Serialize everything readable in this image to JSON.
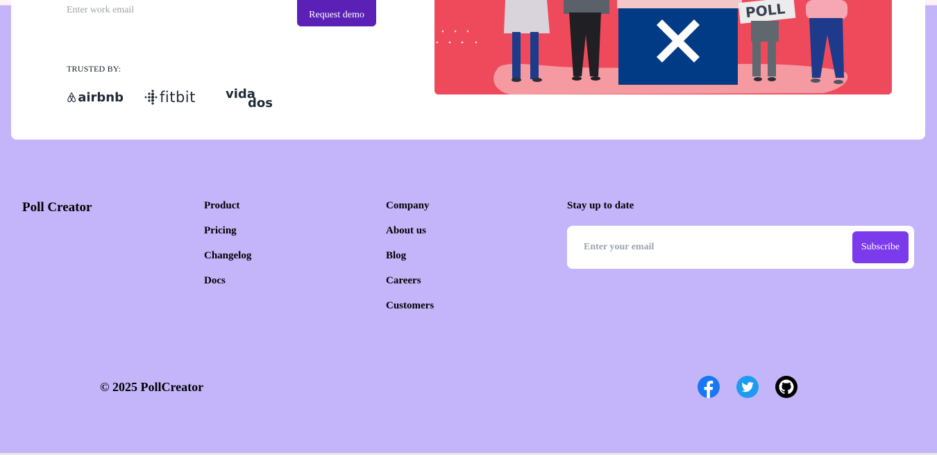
{
  "hero": {
    "work_email_placeholder": "Enter work email",
    "request_demo_label": "Request demo",
    "trusted_label": "TRUSTED BY:",
    "logos": [
      {
        "name": "airbnb",
        "icon": "airbnb-logo"
      },
      {
        "name": "fitbit",
        "icon": "fitbit-logo"
      },
      {
        "name": "vidados",
        "icon": "vidados-logo"
      }
    ],
    "illustration_sign_text": "POLL",
    "colors": {
      "accent": "#5b21b6",
      "illustration_bg": "#ef4a5c",
      "ballot_box": "#013a85"
    }
  },
  "footer": {
    "brand": "Poll Creator",
    "product": {
      "title": "Product",
      "links": [
        "Pricing",
        "Changelog",
        "Docs"
      ]
    },
    "company": {
      "title": "Company",
      "links": [
        "About us",
        "Blog",
        "Careers",
        "Customers"
      ]
    },
    "newsletter": {
      "title": "Stay up to date",
      "placeholder": "Enter your email",
      "button_label": "Subscribe"
    },
    "copyright": "© 2025 PollCreator",
    "social": [
      {
        "icon": "facebook-icon",
        "color": "#1877f2"
      },
      {
        "icon": "twitter-icon",
        "color": "#1d9bf0"
      },
      {
        "icon": "github-icon",
        "color": "#000000"
      }
    ],
    "colors": {
      "background": "#c4b5fb",
      "subscribe_button": "#7c3aed"
    }
  }
}
